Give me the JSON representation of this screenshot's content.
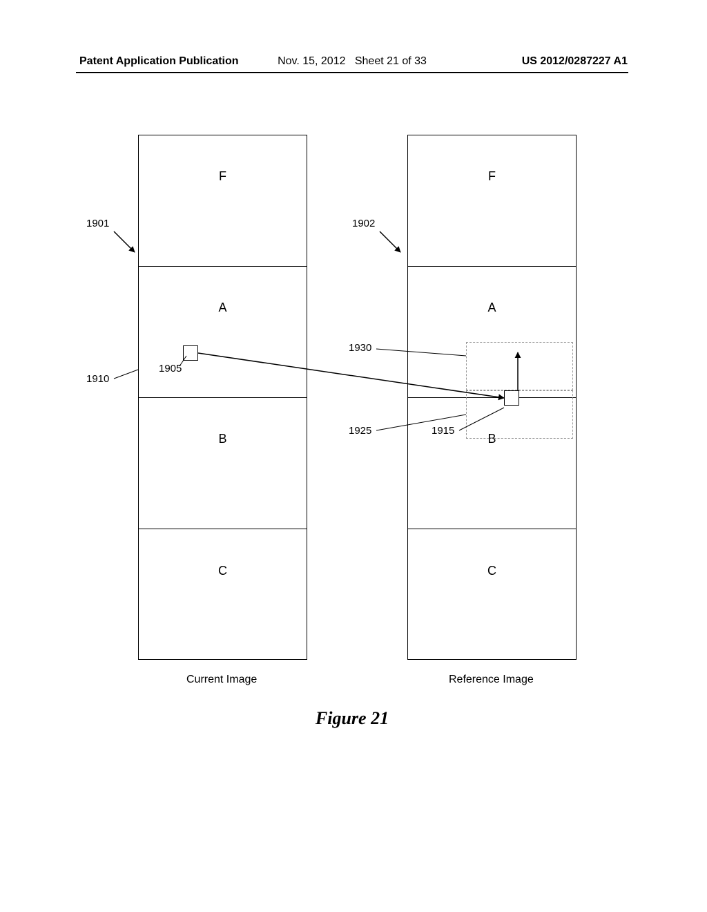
{
  "header": {
    "left": "Patent Application Publication",
    "center_date": "Nov. 15, 2012",
    "center_sheet": "Sheet 21 of 33",
    "right": "US 2012/0287227 A1"
  },
  "rows": {
    "F": "F",
    "A": "A",
    "B": "B",
    "C": "C"
  },
  "captions": {
    "left": "Current Image",
    "right": "Reference Image",
    "figure": "Figure 21"
  },
  "labels": {
    "n1901": "1901",
    "n1902": "1902",
    "n1905": "1905",
    "n1910": "1910",
    "n1915": "1915",
    "n1925": "1925",
    "n1930": "1930"
  }
}
